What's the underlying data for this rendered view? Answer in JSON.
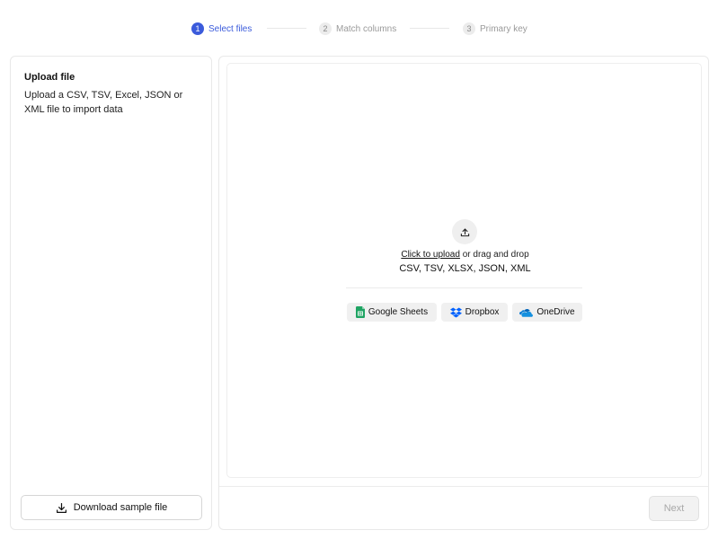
{
  "stepper": {
    "steps": [
      {
        "number": "1",
        "label": "Select files",
        "state": "active"
      },
      {
        "number": "2",
        "label": "Match columns",
        "state": "inactive"
      },
      {
        "number": "3",
        "label": "Primary key",
        "state": "inactive"
      }
    ]
  },
  "sidebar": {
    "title": "Upload file",
    "description": "Upload a CSV, TSV, Excel, JSON or XML file to import data",
    "download_label": "Download sample file"
  },
  "dropzone": {
    "click_to_upload": "Click to upload",
    "drag_text": " or drag and drop",
    "formats": "CSV, TSV, XLSX, JSON, XML",
    "sources": [
      {
        "label": "Google Sheets",
        "icon": "google-sheets-icon"
      },
      {
        "label": "Dropbox",
        "icon": "dropbox-icon"
      },
      {
        "label": "OneDrive",
        "icon": "onedrive-icon"
      }
    ]
  },
  "footer": {
    "next_label": "Next"
  },
  "colors": {
    "accent": "#3b5bdb",
    "google_sheets": "#1fa463",
    "dropbox": "#0061fe",
    "onedrive": "#0364b8"
  }
}
